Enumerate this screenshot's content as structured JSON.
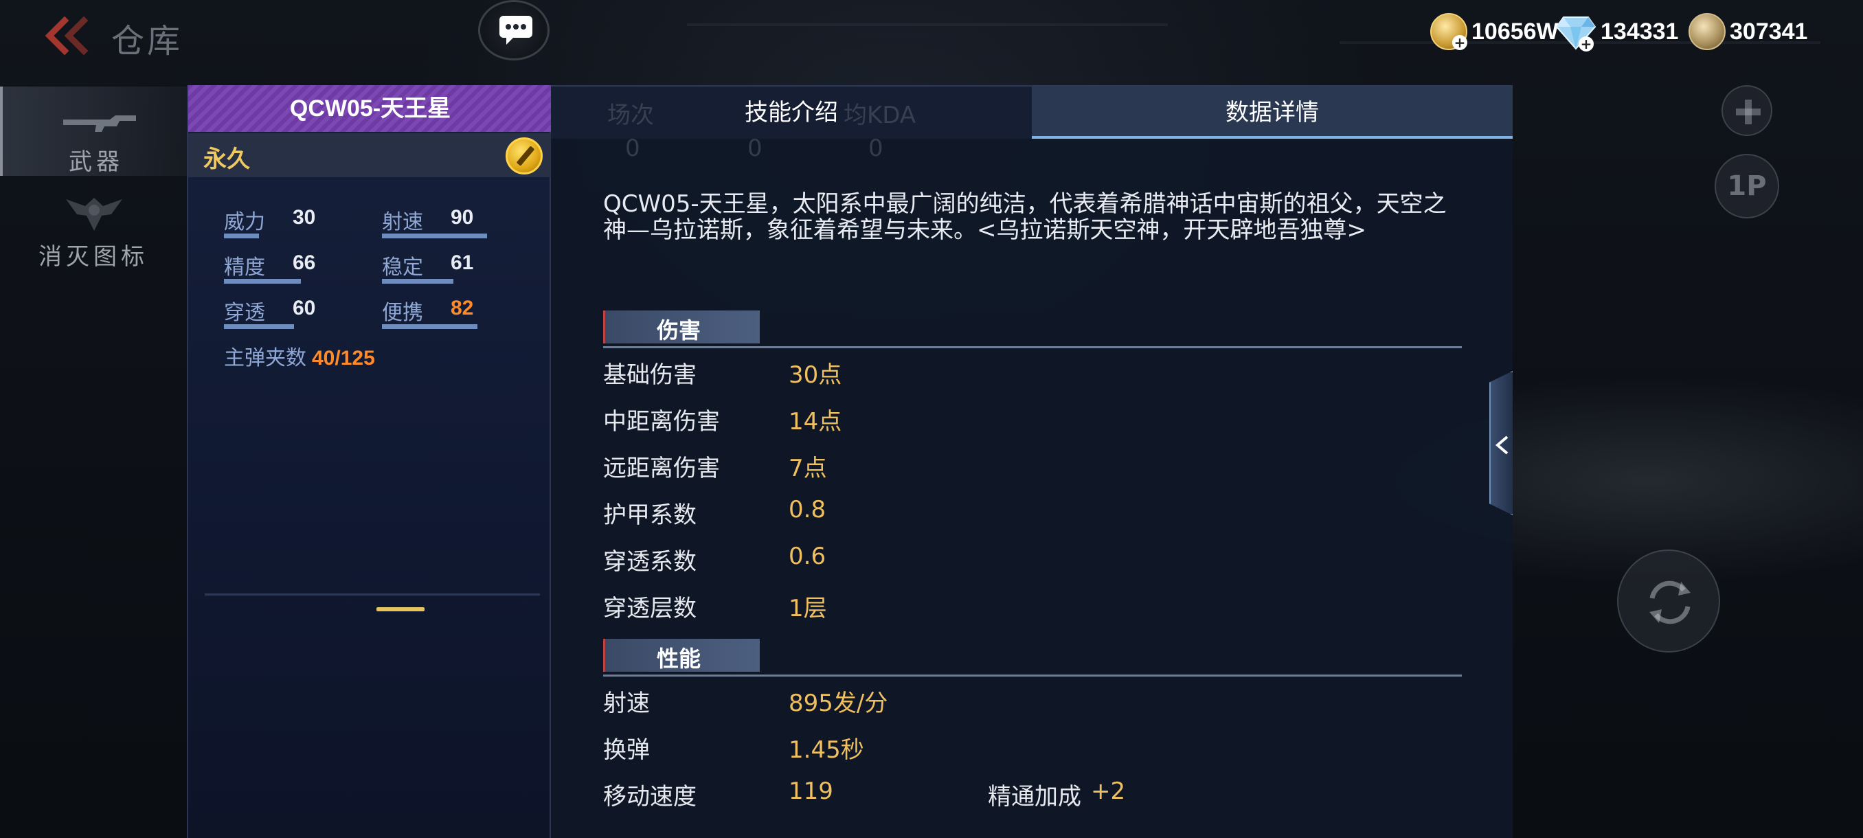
{
  "header": {
    "title": "仓库",
    "currencies": [
      {
        "icon": "gold-coin-icon",
        "value": "10656W"
      },
      {
        "icon": "diamond-icon",
        "value": "134331"
      },
      {
        "icon": "medal-icon",
        "value": "307341"
      }
    ]
  },
  "sidebar": {
    "items": [
      {
        "label": "武器",
        "active": true
      },
      {
        "label": "消灭图标",
        "active": false
      }
    ]
  },
  "weapon": {
    "name": "QCW05-天王星",
    "duration": "永久",
    "stats": [
      {
        "label": "威力",
        "value": "30",
        "fill": 0.3
      },
      {
        "label": "射速",
        "value": "90",
        "fill": 0.9
      },
      {
        "label": "精度",
        "value": "66",
        "fill": 0.66
      },
      {
        "label": "稳定",
        "value": "61",
        "fill": 0.61
      },
      {
        "label": "穿透",
        "value": "60",
        "fill": 0.6
      },
      {
        "label": "便携",
        "value": "82",
        "fill": 0.82
      }
    ],
    "ammo_label": "主弹夹数",
    "ammo_value": "40/125"
  },
  "tabs": {
    "skill": "技能介绍",
    "data": "数据详情",
    "active": "data"
  },
  "ghost_header": {
    "matches": "场次",
    "kda": "均KDA",
    "zero": "0"
  },
  "detail": {
    "description": "QCW05-天王星，太阳系中最广阔的纯洁，代表着希腊神话中宙斯的祖父，天空之神—乌拉诺斯，象征着希望与未来。<乌拉诺斯天空神，开天辟地吾独尊>",
    "sections": [
      {
        "title": "伤害",
        "rows": [
          {
            "label": "基础伤害",
            "value": "30点"
          },
          {
            "label": "中距离伤害",
            "value": "14点"
          },
          {
            "label": "远距离伤害",
            "value": "7点"
          },
          {
            "label": "护甲系数",
            "value": "0.8"
          },
          {
            "label": "穿透系数",
            "value": "0.6"
          },
          {
            "label": "穿透层数",
            "value": "1层"
          }
        ]
      },
      {
        "title": "性能",
        "rows": [
          {
            "label": "射速",
            "value": "895发/分"
          },
          {
            "label": "换弹",
            "value": "1.45秒"
          },
          {
            "label": "移动速度",
            "value": "119",
            "extra_label": "精通加成",
            "extra_value": "+2"
          }
        ]
      }
    ]
  },
  "right_controls": {
    "view_button": "1P"
  },
  "colors": {
    "accent_gold": "#f0c060",
    "stat_highlight": "#ff8a2a",
    "weapon_purple": "#7c48b4",
    "tab_active": "#2a3852"
  }
}
